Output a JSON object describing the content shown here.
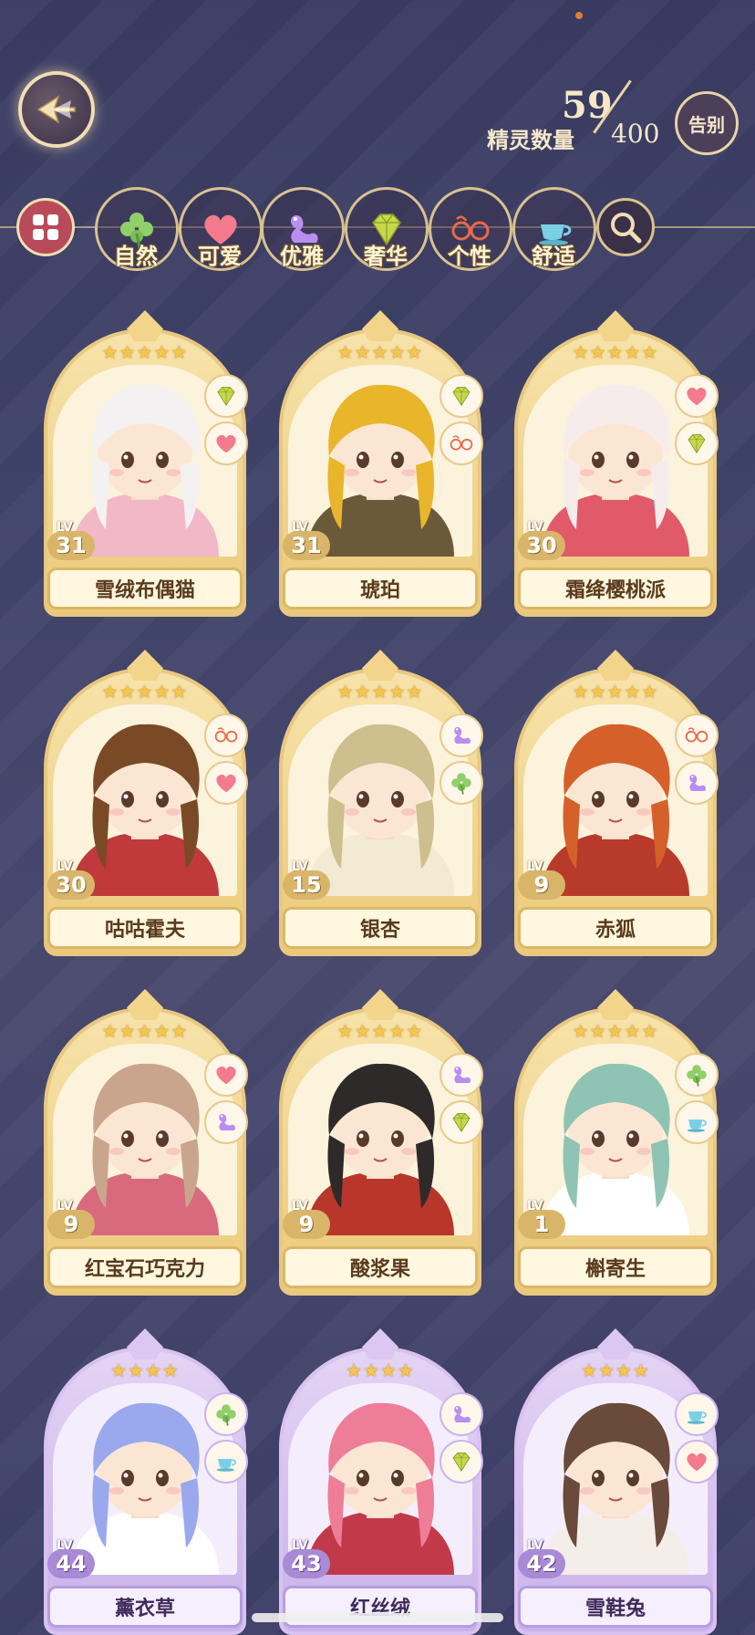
{
  "header": {
    "count_label": "精灵数量",
    "count_current": "59",
    "count_max": "400",
    "farewell_label": "告别"
  },
  "filters": [
    {
      "id": "all",
      "label": "",
      "icon": "grid-icon"
    },
    {
      "id": "nature",
      "label": "自然",
      "icon": "clover-icon"
    },
    {
      "id": "cute",
      "label": "可爱",
      "icon": "heart-icon"
    },
    {
      "id": "elegant",
      "label": "优雅",
      "icon": "swan-icon"
    },
    {
      "id": "luxury",
      "label": "奢华",
      "icon": "diamond-icon"
    },
    {
      "id": "personality",
      "label": "个性",
      "icon": "glasses-icon"
    },
    {
      "id": "comfort",
      "label": "舒适",
      "icon": "teacup-icon"
    },
    {
      "id": "search",
      "label": "",
      "icon": "search-icon"
    }
  ],
  "lv_prefix": "LV",
  "cards": [
    {
      "name": "雪绒布偶猫",
      "level": "31",
      "stars": "★★★★★",
      "badges": [
        "diamond-icon",
        "heart-icon"
      ],
      "rarity": "gold",
      "hair": "#f4f1f2",
      "accent": "#f2b8c8"
    },
    {
      "name": "琥珀",
      "level": "31",
      "stars": "★★★★★",
      "badges": [
        "diamond-icon",
        "glasses-icon"
      ],
      "rarity": "gold",
      "hair": "#e9b52a",
      "accent": "#6b5a3a"
    },
    {
      "name": "霜绛樱桃派",
      "level": "30",
      "stars": "★★★★★",
      "badges": [
        "heart-icon",
        "diamond-icon"
      ],
      "rarity": "gold",
      "hair": "#f7ecec",
      "accent": "#e05a6a"
    },
    {
      "name": "咕咕霍夫",
      "level": "30",
      "stars": "★★★★★",
      "badges": [
        "glasses-icon",
        "heart-icon"
      ],
      "rarity": "gold",
      "hair": "#7a4a26",
      "accent": "#c0393b"
    },
    {
      "name": "银杏",
      "level": "15",
      "stars": "★★★★★",
      "badges": [
        "swan-icon",
        "clover-icon"
      ],
      "rarity": "gold",
      "hair": "#cdbf8e",
      "accent": "#f2ead2"
    },
    {
      "name": "赤狐",
      "level": "9",
      "stars": "★★★★★",
      "badges": [
        "glasses-icon",
        "swan-icon"
      ],
      "rarity": "gold",
      "hair": "#d6602a",
      "accent": "#b83a2a"
    },
    {
      "name": "红宝石巧克力",
      "level": "9",
      "stars": "★★★★★",
      "badges": [
        "heart-icon",
        "swan-icon"
      ],
      "rarity": "gold",
      "hair": "#c9a58e",
      "accent": "#d96a7e"
    },
    {
      "name": "酸浆果",
      "level": "9",
      "stars": "★★★★★",
      "badges": [
        "swan-icon",
        "diamond-icon"
      ],
      "rarity": "gold",
      "hair": "#2e2a2a",
      "accent": "#b8362a"
    },
    {
      "name": "槲寄生",
      "level": "1",
      "stars": "★★★★★",
      "badges": [
        "clover-icon",
        "teacup-icon"
      ],
      "rarity": "gold",
      "hair": "#8fc4b4",
      "accent": "#ffffff"
    },
    {
      "name": "薰衣草",
      "level": "44",
      "stars": "★★★★",
      "badges": [
        "clover-icon",
        "teacup-icon"
      ],
      "rarity": "purple",
      "hair": "#9aa8ee",
      "accent": "#ffffff"
    },
    {
      "name": "红丝绒",
      "level": "43",
      "stars": "★★★★",
      "badges": [
        "swan-icon",
        "diamond-icon"
      ],
      "rarity": "purple",
      "hair": "#ee7e98",
      "accent": "#c23a4a"
    },
    {
      "name": "雪鞋兔",
      "level": "42",
      "stars": "★★★★",
      "badges": [
        "teacup-icon",
        "heart-icon"
      ],
      "rarity": "purple",
      "hair": "#6a4a3a",
      "accent": "#f4eee8"
    }
  ],
  "colors": {
    "background": "#3f4168",
    "gold_frame": "#ecca7a",
    "purple_frame": "#c9b2ea",
    "text_light": "#f6e7c8"
  }
}
